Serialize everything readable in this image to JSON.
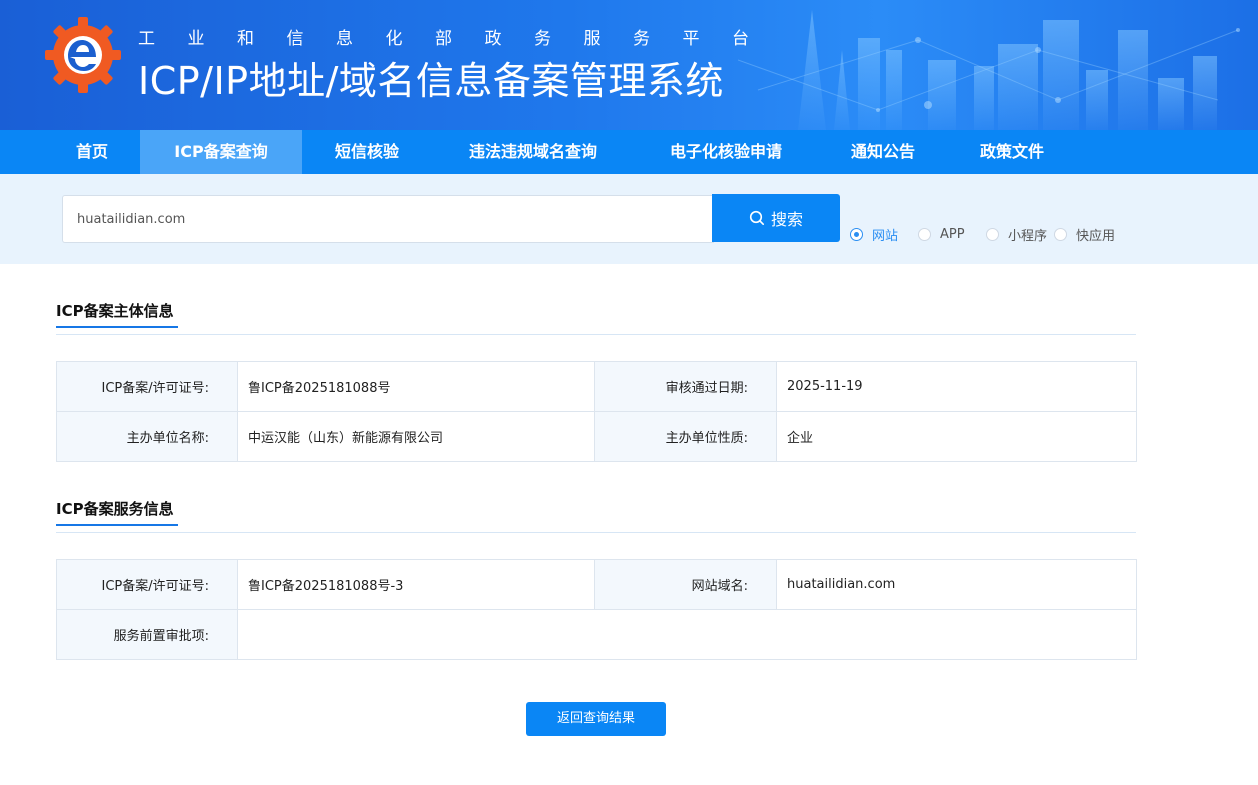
{
  "header": {
    "subtitle": "工业和信息化部政务服务平台",
    "title": "ICP/IP地址/域名信息备案管理系统"
  },
  "nav": {
    "items": [
      "首页",
      "ICP备案查询",
      "短信核验",
      "违法违规域名查询",
      "电子化核验申请",
      "通知公告",
      "政策文件"
    ],
    "active": "ICP备案查询"
  },
  "search": {
    "value": "huatailidian.com",
    "button_label": "搜索",
    "types": [
      "网站",
      "APP",
      "小程序",
      "快应用"
    ],
    "selected_type": "网站"
  },
  "subject_info": {
    "title": "ICP备案主体信息",
    "license_label": "ICP备案/许可证号:",
    "license_value": "鲁ICP备2025181088号",
    "date_label": "审核通过日期:",
    "date_value": "2025-11-19",
    "org_label": "主办单位名称:",
    "org_value": "中运汉能（山东）新能源有限公司",
    "nature_label": "主办单位性质:",
    "nature_value": "企业"
  },
  "service_info": {
    "title": "ICP备案服务信息",
    "license_label": "ICP备案/许可证号:",
    "license_value": "鲁ICP备2025181088号-3",
    "domain_label": "网站域名:",
    "domain_value": "huatailidian.com",
    "approval_label": "服务前置审批项:",
    "approval_value": ""
  },
  "back_button": "返回查询结果",
  "colors": {
    "primary": "#0a86f5",
    "nav_active": "#4aa5f8",
    "search_band": "#e8f3fd",
    "label_cell": "#f3f8fd"
  }
}
